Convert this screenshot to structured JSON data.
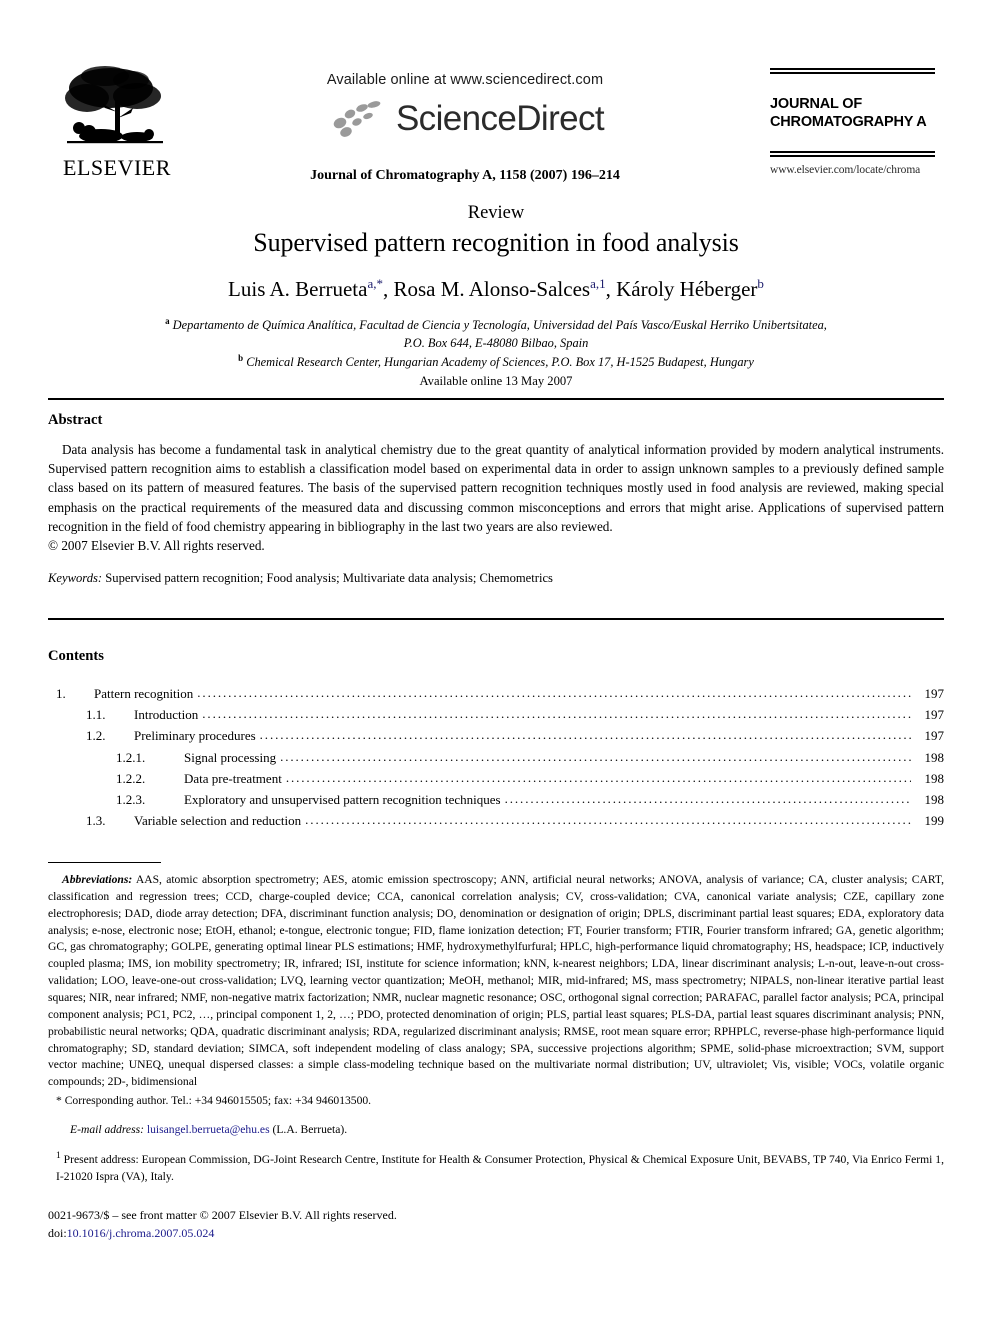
{
  "masthead": {
    "publisher_logo_label": "ELSEVIER",
    "available_online": "Available online at www.sciencedirect.com",
    "sciencedirect_wordmark": "ScienceDirect",
    "journal_citation": "Journal of Chromatography A, 1158 (2007) 196–214",
    "journal_name_line1": "JOURNAL OF",
    "journal_name_line2": "CHROMATOGRAPHY A",
    "journal_homepage": "www.elsevier.com/locate/chroma"
  },
  "article": {
    "doctype": "Review",
    "title": "Supervised pattern recognition in food analysis",
    "authors": [
      {
        "name": "Luis A. Berrueta",
        "marks": "a,*"
      },
      {
        "name": "Rosa M. Alonso-Salces",
        "marks": "a,1"
      },
      {
        "name": "Károly Héberger",
        "marks": "b"
      }
    ],
    "affiliation_a_line1": "Departamento de Química Analítica, Facultad de Ciencia y Tecnología, Universidad del País Vasco/Euskal Herriko Unibertsitatea,",
    "affiliation_a_line2": "P.O. Box 644, E-48080 Bilbao, Spain",
    "affiliation_b": "Chemical Research Center, Hungarian Academy of Sciences, P.O. Box 17, H-1525 Budapest, Hungary",
    "available_online_date": "Available online 13 May 2007"
  },
  "abstract": {
    "heading": "Abstract",
    "body": "Data analysis has become a fundamental task in analytical chemistry due to the great quantity of analytical information provided by modern analytical instruments. Supervised pattern recognition aims to establish a classification model based on experimental data in order to assign unknown samples to a previously defined sample class based on its pattern of measured features. The basis of the supervised pattern recognition techniques mostly used in food analysis are reviewed, making special emphasis on the practical requirements of the measured data and discussing common misconceptions and errors that might arise. Applications of supervised pattern recognition in the field of food chemistry appearing in bibliography in the last two years are also reviewed.",
    "copyright": "© 2007 Elsevier B.V. All rights reserved.",
    "keywords_label": "Keywords:",
    "keywords_value": "Supervised pattern recognition; Food analysis; Multivariate data analysis; Chemometrics"
  },
  "contents": {
    "heading": "Contents",
    "entries": [
      {
        "number": "1.",
        "label": "Pattern recognition",
        "page": "197",
        "level": 1
      },
      {
        "number": "1.1.",
        "label": "Introduction",
        "page": "197",
        "level": 2
      },
      {
        "number": "1.2.",
        "label": "Preliminary procedures",
        "page": "197",
        "level": 2
      },
      {
        "number": "1.2.1.",
        "label": "Signal processing",
        "page": "198",
        "level": 3
      },
      {
        "number": "1.2.2.",
        "label": "Data pre-treatment",
        "page": "198",
        "level": 3
      },
      {
        "number": "1.2.3.",
        "label": "Exploratory and unsupervised pattern recognition techniques",
        "page": "198",
        "level": 3
      },
      {
        "number": "1.3.",
        "label": "Variable selection and reduction",
        "page": "199",
        "level": 2
      }
    ]
  },
  "footnotes": {
    "abbreviations_label": "Abbreviations:",
    "abbreviations_text": "AAS, atomic absorption spectrometry; AES, atomic emission spectroscopy; ANN, artificial neural networks; ANOVA, analysis of variance; CA, cluster analysis; CART, classification and regression trees; CCD, charge-coupled device; CCA, canonical correlation analysis; CV, cross-validation; CVA, canonical variate analysis; CZE, capillary zone electrophoresis; DAD, diode array detection; DFA, discriminant function analysis; DO, denomination or designation of origin; DPLS, discriminant partial least squares; EDA, exploratory data analysis; e-nose, electronic nose; EtOH, ethanol; e-tongue, electronic tongue; FID, flame ionization detection; FT, Fourier transform; FTIR, Fourier transform infrared; GA, genetic algorithm; GC, gas chromatography; GOLPE, generating optimal linear PLS estimations; HMF, hydroxymethylfurfural; HPLC, high-performance liquid chromatography; HS, headspace; ICP, inductively coupled plasma; IMS, ion mobility spectrometry; IR, infrared; ISI, institute for science information; kNN, k-nearest neighbors; LDA, linear discriminant analysis; L-n-out, leave-n-out cross-validation; LOO, leave-one-out cross-validation; LVQ, learning vector quantization; MeOH, methanol; MIR, mid-infrared; MS, mass spectrometry; NIPALS, non-linear iterative partial least squares; NIR, near infrared; NMF, non-negative matrix factorization; NMR, nuclear magnetic resonance; OSC, orthogonal signal correction; PARAFAC, parallel factor analysis; PCA, principal component analysis; PC1, PC2, …, principal component 1, 2, …; PDO, protected denomination of origin; PLS, partial least squares; PLS-DA, partial least squares discriminant analysis; PNN, probabilistic neural networks; QDA, quadratic discriminant analysis; RDA, regularized discriminant analysis; RMSE, root mean square error; RPHPLC, reverse-phase high-performance liquid chromatography; SD, standard deviation; SIMCA, soft independent modeling of class analogy; SPA, successive projections algorithm; SPME, solid-phase microextraction; SVM, support vector machine; UNEQ, unequal dispersed classes: a simple class-modeling technique based on the multivariate normal distribution; UV, ultraviolet; Vis, visible; VOCs, volatile organic compounds; 2D-, bidimensional",
    "corresponding_author": "* Corresponding author. Tel.: +34 946015505; fax: +34 946013500.",
    "email_label": "E-mail address:",
    "email_value": "luisangel.berrueta@ehu.es",
    "email_tail": "(L.A. Berrueta).",
    "present_address_marker": "1",
    "present_address": "Present address: European Commission, DG-Joint Research Centre, Institute for Health & Consumer Protection, Physical & Chemical Exposure Unit, BEVABS, TP 740, Via Enrico Fermi 1, I-21020 Ispra (VA), Italy."
  },
  "bottom": {
    "issn_line": "0021-9673/$ – see front matter © 2007 Elsevier B.V. All rights reserved.",
    "doi_label": "doi:",
    "doi_value": "10.1016/j.chroma.2007.05.024"
  },
  "colors": {
    "link_blue": "#1b1b8c",
    "rule_black": "#000000"
  }
}
